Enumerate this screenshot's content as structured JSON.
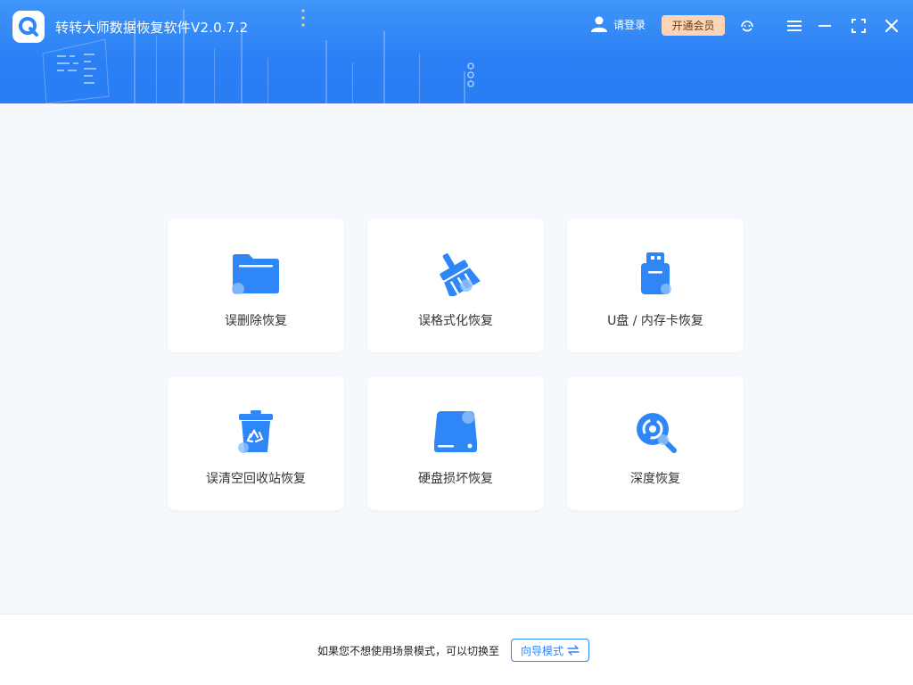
{
  "app": {
    "title": "转转大师数据恢复软件V2.0.7.2"
  },
  "header": {
    "login_label": "请登录",
    "vip_label": "开通会员",
    "icons": [
      "support-icon",
      "menu-icon",
      "minimize-icon",
      "maximize-icon",
      "close-icon"
    ]
  },
  "cards": [
    {
      "label": "误删除恢复",
      "icon": "folder-icon"
    },
    {
      "label": "误格式化恢复",
      "icon": "broom-icon"
    },
    {
      "label": "U盘 / 内存卡恢复",
      "icon": "usb-drive-icon"
    },
    {
      "label": "误清空回收站恢复",
      "icon": "recycle-bin-icon"
    },
    {
      "label": "硬盘损坏恢复",
      "icon": "hard-disk-icon"
    },
    {
      "label": "深度恢复",
      "icon": "deep-scan-icon"
    }
  ],
  "footer": {
    "hint": "如果您不想使用场景模式，可以切换至",
    "guide_button": "向导模式"
  },
  "colors": {
    "header_blue": "#2b7ff5",
    "accent_blue": "#2f86f6",
    "vip_bg": "#fbd5b5",
    "page_bg": "#f5f8fc"
  }
}
